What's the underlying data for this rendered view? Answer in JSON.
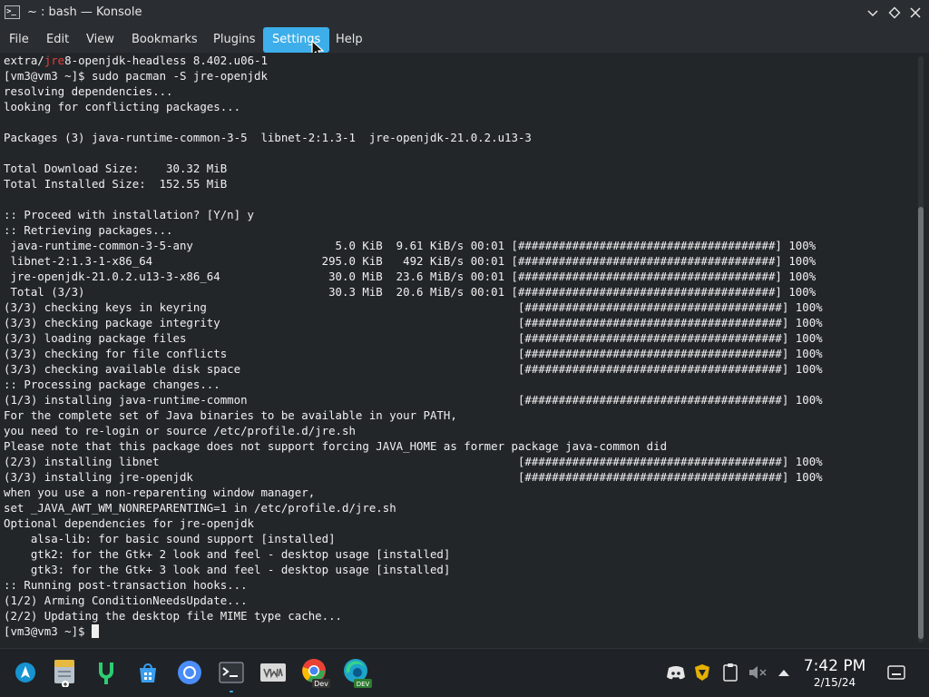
{
  "window": {
    "title": "~ : bash — Konsole",
    "app_icon": ">_"
  },
  "menubar": {
    "items": [
      {
        "label": "File"
      },
      {
        "label": "Edit"
      },
      {
        "label": "View"
      },
      {
        "label": "Bookmarks"
      },
      {
        "label": "Plugins"
      },
      {
        "label": "Settings"
      },
      {
        "label": "Help"
      }
    ],
    "active": "Settings"
  },
  "terminal": {
    "line0": {
      "pre": "extra/",
      "match": "jre",
      "post": "8-openjdk-headless 8.402.u06-1"
    },
    "lines": [
      "[vm3@vm3 ~]$ sudo pacman -S jre-openjdk",
      "resolving dependencies...",
      "looking for conflicting packages...",
      "",
      "Packages (3) java-runtime-common-3-5  libnet-2:1.3-1  jre-openjdk-21.0.2.u13-3",
      "",
      "Total Download Size:    30.32 MiB",
      "Total Installed Size:  152.55 MiB",
      "",
      ":: Proceed with installation? [Y/n] y",
      ":: Retrieving packages...",
      " java-runtime-common-3-5-any                     5.0 KiB  9.61 KiB/s 00:01 [######################################] 100%",
      " libnet-2:1.3-1-x86_64                         295.0 KiB   492 KiB/s 00:01 [######################################] 100%",
      " jre-openjdk-21.0.2.u13-3-x86_64                30.0 MiB  23.6 MiB/s 00:01 [######################################] 100%",
      " Total (3/3)                                    30.3 MiB  20.6 MiB/s 00:01 [######################################] 100%",
      "(3/3) checking keys in keyring                                              [######################################] 100%",
      "(3/3) checking package integrity                                            [######################################] 100%",
      "(3/3) loading package files                                                 [######################################] 100%",
      "(3/3) checking for file conflicts                                           [######################################] 100%",
      "(3/3) checking available disk space                                         [######################################] 100%",
      ":: Processing package changes...",
      "(1/3) installing java-runtime-common                                        [######################################] 100%",
      "For the complete set of Java binaries to be available in your PATH,",
      "you need to re-login or source /etc/profile.d/jre.sh",
      "Please note that this package does not support forcing JAVA_HOME as former package java-common did",
      "(2/3) installing libnet                                                     [######################################] 100%",
      "(3/3) installing jre-openjdk                                                [######################################] 100%",
      "when you use a non-reparenting window manager,",
      "set _JAVA_AWT_WM_NONREPARENTING=1 in /etc/profile.d/jre.sh",
      "Optional dependencies for jre-openjdk",
      "    alsa-lib: for basic sound support [installed]",
      "    gtk2: for the Gtk+ 2 look and feel - desktop usage [installed]",
      "    gtk3: for the Gtk+ 3 look and feel - desktop usage [installed]",
      ":: Running post-transaction hooks...",
      "(1/2) Arming ConditionNeedsUpdate...",
      "(2/2) Updating the desktop file MIME type cache..."
    ],
    "prompt": "[vm3@vm3 ~]$ "
  },
  "taskbar": {
    "apps": [
      {
        "name": "arch-launcher-icon",
        "color": "#1793d1"
      },
      {
        "name": "file-manager-icon",
        "color": "#b8c2cc"
      },
      {
        "name": "kde-connect-icon",
        "color": "#2ecc71"
      },
      {
        "name": "discover-store-icon",
        "color": "#3a9ff0"
      },
      {
        "name": "chromium-icon",
        "color": "#4b8df8"
      },
      {
        "name": "konsole-icon",
        "color": "#31363b"
      },
      {
        "name": "vmware-icon",
        "color": "#d9d9d9"
      },
      {
        "name": "chrome-dev-icon",
        "color": "#e94235"
      },
      {
        "name": "edge-dev-icon",
        "color": "#1fa4c9"
      }
    ],
    "badges": {
      "chrome_dev": "Dev",
      "edge_dev": "DEV"
    },
    "tray": [
      "discord-icon",
      "shield-icon",
      "clipboard-icon",
      "volume-muted-icon",
      "expand-tray-icon"
    ],
    "clock": {
      "time": "7:42 PM",
      "date": "2/15/24"
    }
  }
}
